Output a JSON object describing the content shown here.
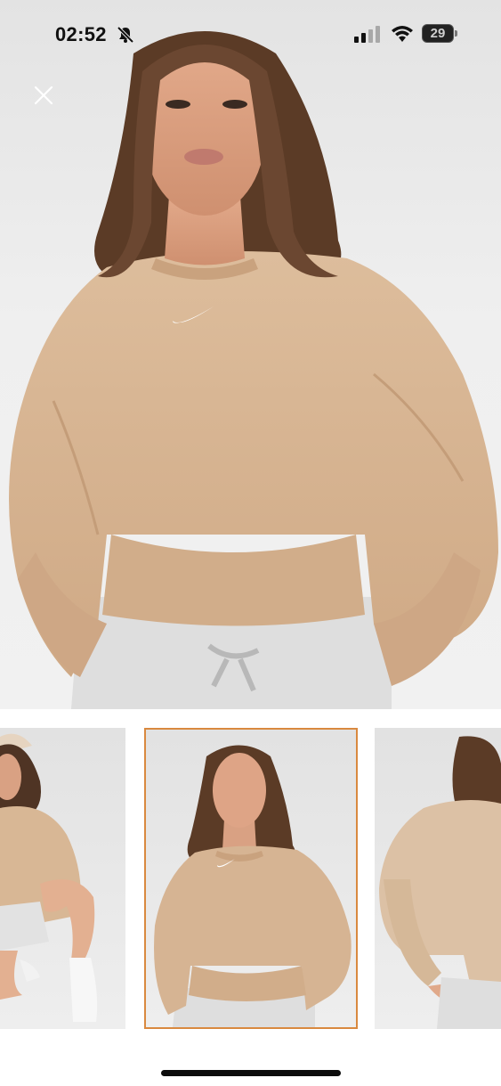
{
  "status_bar": {
    "time": "02:52",
    "battery_level": "29",
    "icons": [
      "bell-off-icon",
      "signal-icon",
      "wifi-icon",
      "battery-icon"
    ]
  },
  "viewer": {
    "close_icon": "close-icon",
    "main_image_alt": "",
    "thumbnails": [
      {
        "id": "thumb-1",
        "selected": false
      },
      {
        "id": "thumb-2",
        "selected": true
      },
      {
        "id": "thumb-3",
        "selected": false
      }
    ],
    "selected_border_color": "#d9893f"
  },
  "colors": {
    "sweatshirt": "#d6b493",
    "background": "#ececec",
    "sweatpants": "#e0e0e0"
  }
}
